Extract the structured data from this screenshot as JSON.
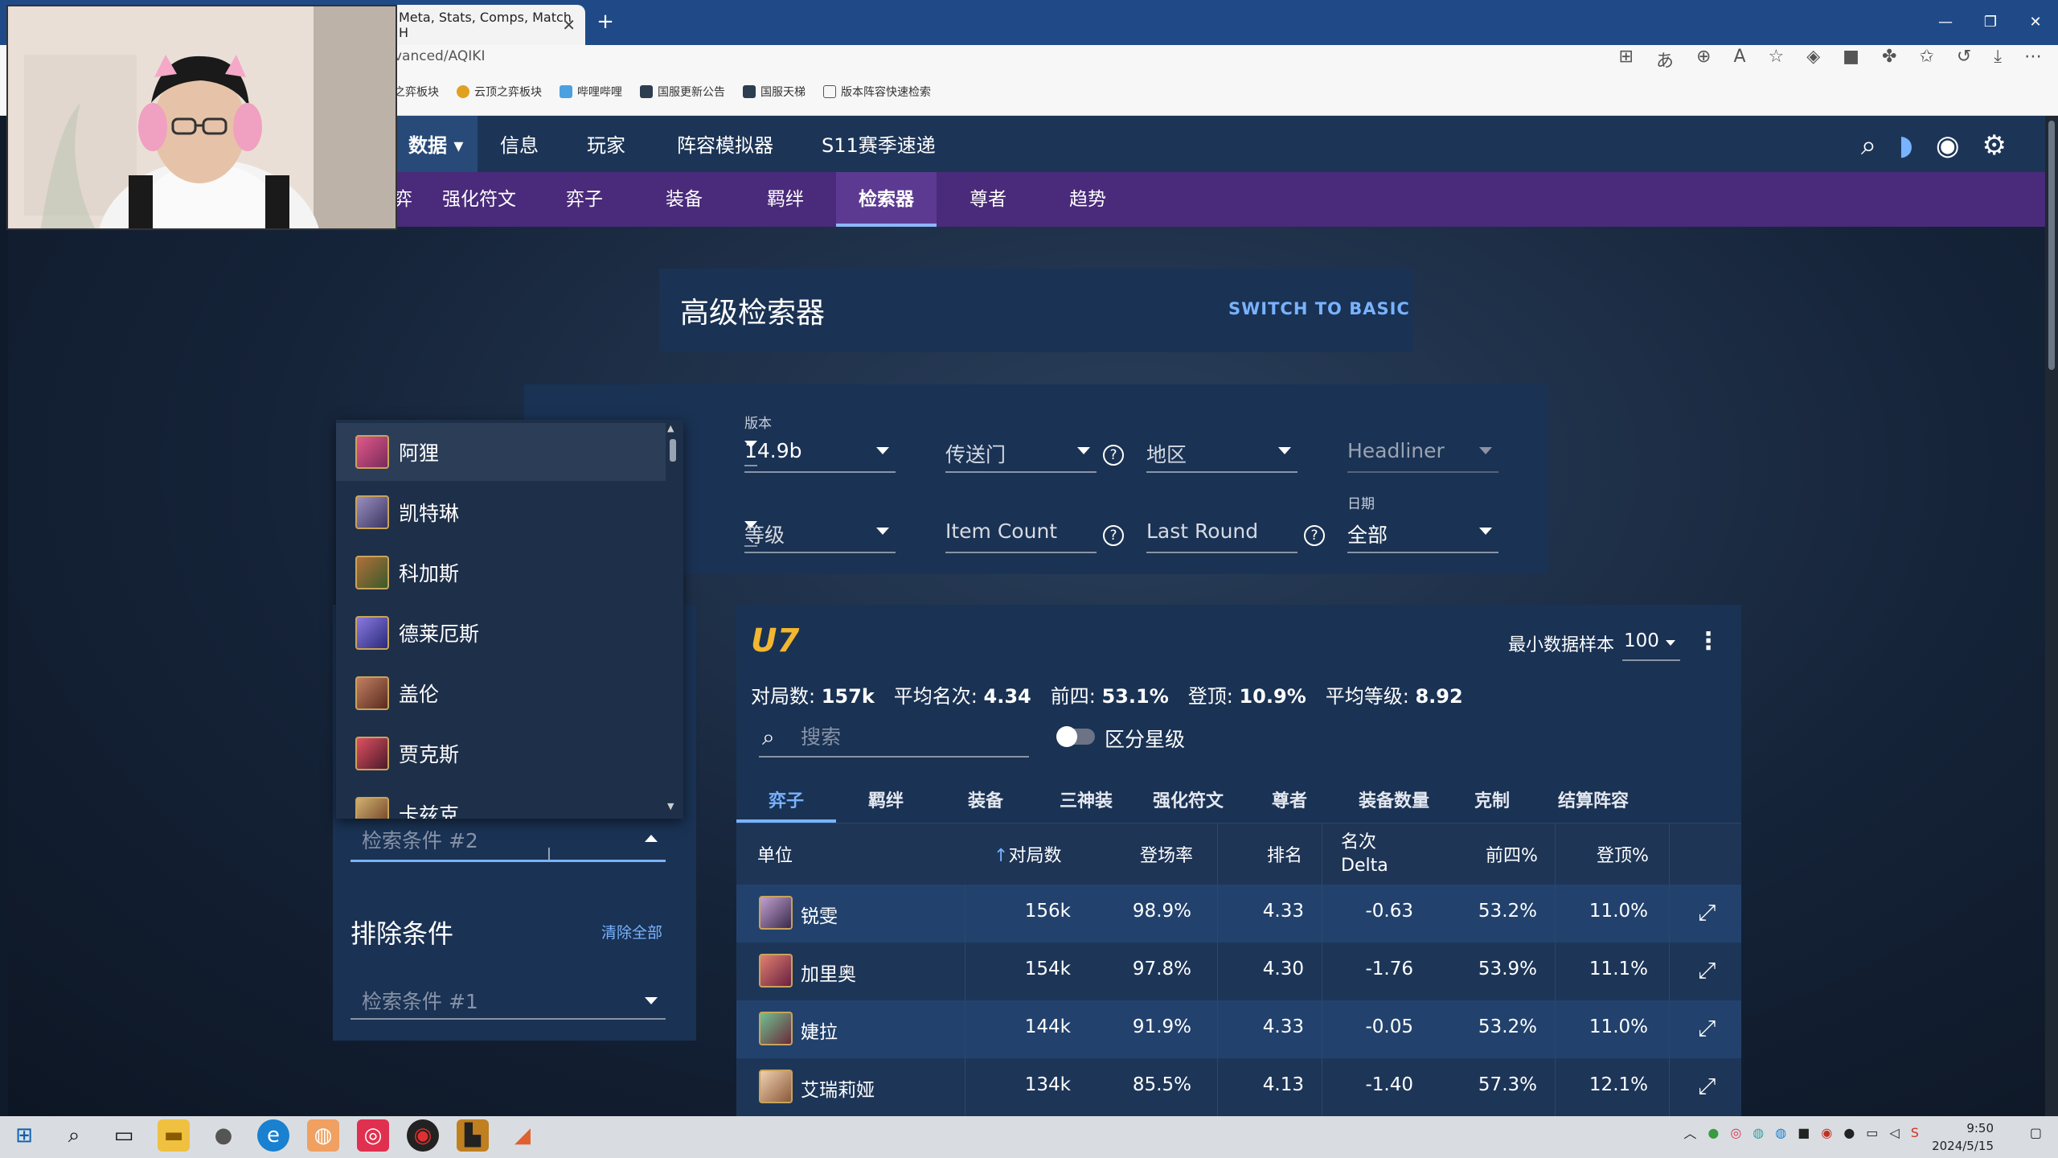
{
  "browser": {
    "tab_title": "Meta, Stats, Comps, Match H",
    "url": "vanced/AQIKI",
    "bookmarks": [
      "之弈板块",
      "云顶之弈板块",
      "哔哩哔哩",
      "国服更新公告",
      "国服天梯",
      "版本阵容快速检索"
    ]
  },
  "nav": {
    "main": [
      "数据",
      "信息",
      "玩家",
      "阵容模拟器",
      "S11赛季速递"
    ],
    "sub": [
      "弈",
      "强化符文",
      "弈子",
      "装备",
      "羁绊",
      "检索器",
      "尊者",
      "趋势"
    ]
  },
  "header": {
    "title": "高级检索器",
    "switch": "SWITCH TO BASIC"
  },
  "filters": {
    "version_label": "版本",
    "version": "14.9b",
    "portal": "传送门",
    "region": "地区",
    "headliner": "Headliner",
    "level": "等级",
    "item_count": "Item Count",
    "last_round": "Last Round",
    "date_label": "日期",
    "date": "全部",
    "help": "?"
  },
  "dropdown": {
    "items": [
      "阿狸",
      "凯特琳",
      "科加斯",
      "德莱厄斯",
      "盖伦",
      "贾克斯",
      "卡兹克"
    ]
  },
  "left_panel": {
    "cond2_placeholder": "检索条件 #2",
    "exclude_title": "排除条件",
    "clear_all": "清除全部",
    "cond1_placeholder": "检索条件 #1"
  },
  "results": {
    "logo": "U7",
    "min_sample_label": "最小数据样本",
    "min_sample": "100",
    "stats": [
      {
        "label": "对局数:",
        "value": "157k"
      },
      {
        "label": "平均名次:",
        "value": "4.34"
      },
      {
        "label": "前四:",
        "value": "53.1%"
      },
      {
        "label": "登顶:",
        "value": "10.9%"
      },
      {
        "label": "平均等级:",
        "value": "8.92"
      }
    ],
    "search_placeholder": "搜索",
    "toggle_label": "区分星级",
    "tabs": [
      "弈子",
      "羁绊",
      "装备",
      "三神装",
      "强化符文",
      "尊者",
      "装备数量",
      "克制",
      "结算阵容"
    ],
    "columns": {
      "unit": "单位",
      "games": "对局数",
      "pick_rate": "登场率",
      "place": "排名",
      "delta_1": "名次",
      "delta_2": "Delta",
      "top4": "前四%",
      "win": "登顶%"
    },
    "rows": [
      {
        "name": "锐雯",
        "games": "156k",
        "pick": "98.9%",
        "place": "4.33",
        "delta": "-0.63",
        "top4": "53.2%",
        "win": "11.0%"
      },
      {
        "name": "加里奥",
        "games": "154k",
        "pick": "97.8%",
        "place": "4.30",
        "delta": "-1.76",
        "top4": "53.9%",
        "win": "11.1%"
      },
      {
        "name": "婕拉",
        "games": "144k",
        "pick": "91.9%",
        "place": "4.33",
        "delta": "-0.05",
        "top4": "53.2%",
        "win": "11.0%"
      },
      {
        "name": "艾瑞莉娅",
        "games": "134k",
        "pick": "85.5%",
        "place": "4.13",
        "delta": "-1.40",
        "top4": "57.3%",
        "win": "12.1%"
      }
    ]
  },
  "taskbar": {
    "time": "9:50",
    "date": "2024/5/15"
  },
  "colors": {
    "accent": "#79b2ff",
    "nav_main": "#1c3557",
    "nav_sub": "#4a2a7a",
    "card": "#1a3253"
  }
}
